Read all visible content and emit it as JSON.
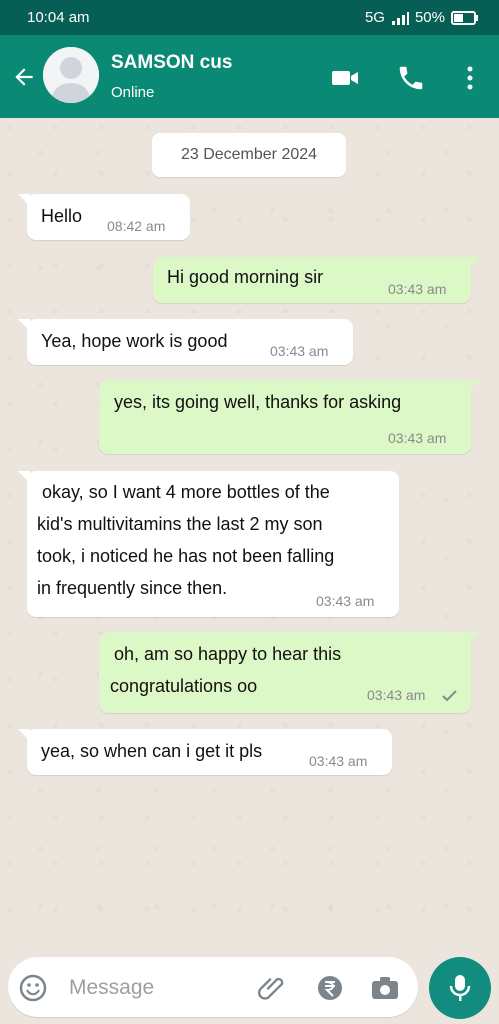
{
  "status": {
    "time": "10:04 am",
    "network": "5G",
    "battery": "50%"
  },
  "header": {
    "name": "SAMSON cus",
    "presence": "Online"
  },
  "chat": {
    "date": "23 December 2024",
    "messages": [
      {
        "dir": "in",
        "text": "Hello",
        "time": "08:42 am"
      },
      {
        "dir": "out",
        "text": "Hi good morning sir",
        "time": "03:43 am"
      },
      {
        "dir": "in",
        "text": "Yea, hope work is good",
        "time": "03:43 am"
      },
      {
        "dir": "out",
        "text": "yes, its going well, thanks for asking",
        "time": "03:43 am"
      },
      {
        "dir": "in",
        "lines": [
          " okay, so I want 4 more bottles of the",
          "kid's multivitamins the last 2 my son",
          "took, i noticed he has not been falling",
          "in frequently since then."
        ],
        "time": "03:43 am"
      },
      {
        "dir": "out",
        "lines": [
          "oh, am so happy to hear this",
          "congratulations oo"
        ],
        "time": "03:43 am",
        "status": "sent"
      },
      {
        "dir": "in",
        "text": "yea, so when can i get it pls",
        "time": "03:43 am"
      }
    ]
  },
  "composer": {
    "placeholder": "Message"
  },
  "icons": {
    "back": "arrow-left-icon",
    "avatar": "person-icon",
    "video": "video-call-icon",
    "voice": "phone-icon",
    "menu": "more-vertical-icon",
    "emoji": "emoji-icon",
    "attach": "paperclip-icon",
    "payment": "rupee-icon",
    "camera": "camera-icon",
    "mic": "microphone-icon"
  },
  "colors": {
    "header": "#0a8a74",
    "status_bar": "#075e54",
    "outgoing": "#dcf8c6",
    "incoming": "#ffffff",
    "background": "#ece5dd",
    "mic_button": "#128c7e"
  }
}
